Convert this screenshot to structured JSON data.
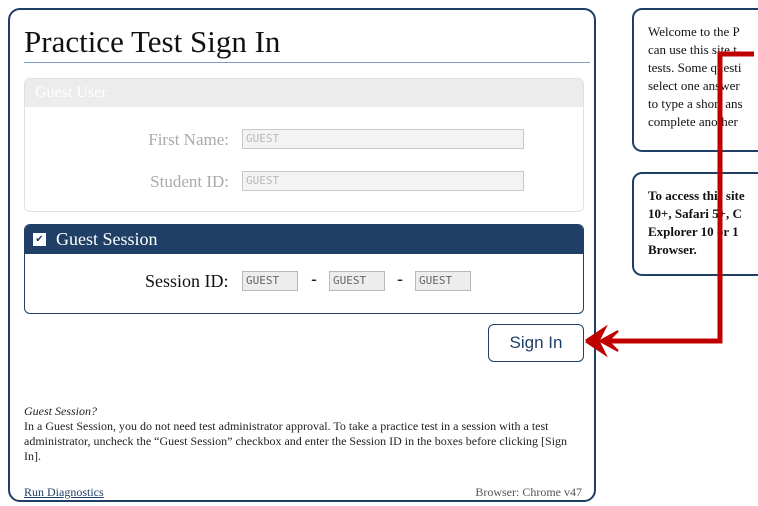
{
  "page_title": "Practice Test Sign In",
  "guest_user": {
    "header": "Guest User",
    "first_name_label": "First Name:",
    "first_name_value": "GUEST",
    "student_id_label": "Student ID:",
    "student_id_value": "GUEST"
  },
  "guest_session": {
    "header": "Guest Session",
    "checked": true,
    "session_id_label": "Session ID:",
    "part1": "GUEST",
    "part2": "GUEST",
    "part3": "GUEST",
    "separator": "-"
  },
  "sign_in_label": "Sign In",
  "note": {
    "title": "Guest Session?",
    "body": "In a Guest Session, you do not need test administrator approval. To take a practice test in a session with a test administrator, uncheck the “Guest Session” checkbox and enter the Session ID in the boxes before clicking [Sign In]."
  },
  "run_diagnostics_label": "Run Diagnostics",
  "browser_info": "Browser: Chrome v47",
  "welcome_lines": [
    "Welcome to the P",
    "can use this site t",
    "tests. Some questi",
    "select one answer",
    "to type a short ans",
    "complete another"
  ],
  "access_lines": [
    "To access this site",
    "10+, Safari 5+, C",
    "Explorer 10 or 1",
    "Browser."
  ],
  "colors": {
    "navy": "#1f3f66",
    "arrow_red": "#c00000"
  }
}
